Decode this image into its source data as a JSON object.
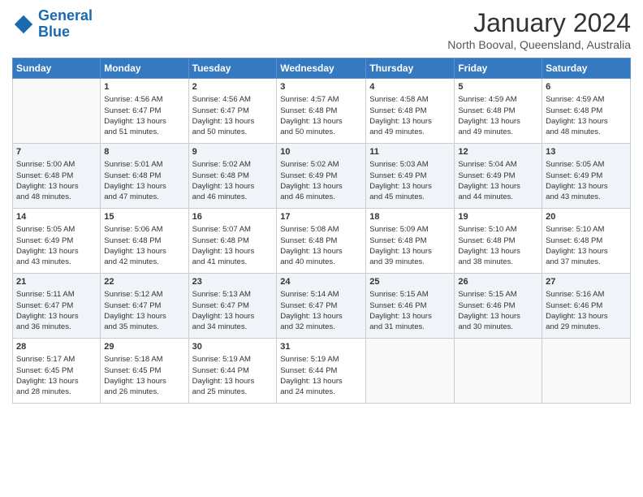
{
  "logo": {
    "line1": "General",
    "line2": "Blue"
  },
  "title": "January 2024",
  "subtitle": "North Booval, Queensland, Australia",
  "weekdays": [
    "Sunday",
    "Monday",
    "Tuesday",
    "Wednesday",
    "Thursday",
    "Friday",
    "Saturday"
  ],
  "weeks": [
    [
      {
        "day": "",
        "lines": []
      },
      {
        "day": "1",
        "lines": [
          "Sunrise: 4:56 AM",
          "Sunset: 6:47 PM",
          "Daylight: 13 hours",
          "and 51 minutes."
        ]
      },
      {
        "day": "2",
        "lines": [
          "Sunrise: 4:56 AM",
          "Sunset: 6:47 PM",
          "Daylight: 13 hours",
          "and 50 minutes."
        ]
      },
      {
        "day": "3",
        "lines": [
          "Sunrise: 4:57 AM",
          "Sunset: 6:48 PM",
          "Daylight: 13 hours",
          "and 50 minutes."
        ]
      },
      {
        "day": "4",
        "lines": [
          "Sunrise: 4:58 AM",
          "Sunset: 6:48 PM",
          "Daylight: 13 hours",
          "and 49 minutes."
        ]
      },
      {
        "day": "5",
        "lines": [
          "Sunrise: 4:59 AM",
          "Sunset: 6:48 PM",
          "Daylight: 13 hours",
          "and 49 minutes."
        ]
      },
      {
        "day": "6",
        "lines": [
          "Sunrise: 4:59 AM",
          "Sunset: 6:48 PM",
          "Daylight: 13 hours",
          "and 48 minutes."
        ]
      }
    ],
    [
      {
        "day": "7",
        "lines": [
          "Sunrise: 5:00 AM",
          "Sunset: 6:48 PM",
          "Daylight: 13 hours",
          "and 48 minutes."
        ]
      },
      {
        "day": "8",
        "lines": [
          "Sunrise: 5:01 AM",
          "Sunset: 6:48 PM",
          "Daylight: 13 hours",
          "and 47 minutes."
        ]
      },
      {
        "day": "9",
        "lines": [
          "Sunrise: 5:02 AM",
          "Sunset: 6:48 PM",
          "Daylight: 13 hours",
          "and 46 minutes."
        ]
      },
      {
        "day": "10",
        "lines": [
          "Sunrise: 5:02 AM",
          "Sunset: 6:49 PM",
          "Daylight: 13 hours",
          "and 46 minutes."
        ]
      },
      {
        "day": "11",
        "lines": [
          "Sunrise: 5:03 AM",
          "Sunset: 6:49 PM",
          "Daylight: 13 hours",
          "and 45 minutes."
        ]
      },
      {
        "day": "12",
        "lines": [
          "Sunrise: 5:04 AM",
          "Sunset: 6:49 PM",
          "Daylight: 13 hours",
          "and 44 minutes."
        ]
      },
      {
        "day": "13",
        "lines": [
          "Sunrise: 5:05 AM",
          "Sunset: 6:49 PM",
          "Daylight: 13 hours",
          "and 43 minutes."
        ]
      }
    ],
    [
      {
        "day": "14",
        "lines": [
          "Sunrise: 5:05 AM",
          "Sunset: 6:49 PM",
          "Daylight: 13 hours",
          "and 43 minutes."
        ]
      },
      {
        "day": "15",
        "lines": [
          "Sunrise: 5:06 AM",
          "Sunset: 6:48 PM",
          "Daylight: 13 hours",
          "and 42 minutes."
        ]
      },
      {
        "day": "16",
        "lines": [
          "Sunrise: 5:07 AM",
          "Sunset: 6:48 PM",
          "Daylight: 13 hours",
          "and 41 minutes."
        ]
      },
      {
        "day": "17",
        "lines": [
          "Sunrise: 5:08 AM",
          "Sunset: 6:48 PM",
          "Daylight: 13 hours",
          "and 40 minutes."
        ]
      },
      {
        "day": "18",
        "lines": [
          "Sunrise: 5:09 AM",
          "Sunset: 6:48 PM",
          "Daylight: 13 hours",
          "and 39 minutes."
        ]
      },
      {
        "day": "19",
        "lines": [
          "Sunrise: 5:10 AM",
          "Sunset: 6:48 PM",
          "Daylight: 13 hours",
          "and 38 minutes."
        ]
      },
      {
        "day": "20",
        "lines": [
          "Sunrise: 5:10 AM",
          "Sunset: 6:48 PM",
          "Daylight: 13 hours",
          "and 37 minutes."
        ]
      }
    ],
    [
      {
        "day": "21",
        "lines": [
          "Sunrise: 5:11 AM",
          "Sunset: 6:47 PM",
          "Daylight: 13 hours",
          "and 36 minutes."
        ]
      },
      {
        "day": "22",
        "lines": [
          "Sunrise: 5:12 AM",
          "Sunset: 6:47 PM",
          "Daylight: 13 hours",
          "and 35 minutes."
        ]
      },
      {
        "day": "23",
        "lines": [
          "Sunrise: 5:13 AM",
          "Sunset: 6:47 PM",
          "Daylight: 13 hours",
          "and 34 minutes."
        ]
      },
      {
        "day": "24",
        "lines": [
          "Sunrise: 5:14 AM",
          "Sunset: 6:47 PM",
          "Daylight: 13 hours",
          "and 32 minutes."
        ]
      },
      {
        "day": "25",
        "lines": [
          "Sunrise: 5:15 AM",
          "Sunset: 6:46 PM",
          "Daylight: 13 hours",
          "and 31 minutes."
        ]
      },
      {
        "day": "26",
        "lines": [
          "Sunrise: 5:15 AM",
          "Sunset: 6:46 PM",
          "Daylight: 13 hours",
          "and 30 minutes."
        ]
      },
      {
        "day": "27",
        "lines": [
          "Sunrise: 5:16 AM",
          "Sunset: 6:46 PM",
          "Daylight: 13 hours",
          "and 29 minutes."
        ]
      }
    ],
    [
      {
        "day": "28",
        "lines": [
          "Sunrise: 5:17 AM",
          "Sunset: 6:45 PM",
          "Daylight: 13 hours",
          "and 28 minutes."
        ]
      },
      {
        "day": "29",
        "lines": [
          "Sunrise: 5:18 AM",
          "Sunset: 6:45 PM",
          "Daylight: 13 hours",
          "and 26 minutes."
        ]
      },
      {
        "day": "30",
        "lines": [
          "Sunrise: 5:19 AM",
          "Sunset: 6:44 PM",
          "Daylight: 13 hours",
          "and 25 minutes."
        ]
      },
      {
        "day": "31",
        "lines": [
          "Sunrise: 5:19 AM",
          "Sunset: 6:44 PM",
          "Daylight: 13 hours",
          "and 24 minutes."
        ]
      },
      {
        "day": "",
        "lines": []
      },
      {
        "day": "",
        "lines": []
      },
      {
        "day": "",
        "lines": []
      }
    ]
  ]
}
